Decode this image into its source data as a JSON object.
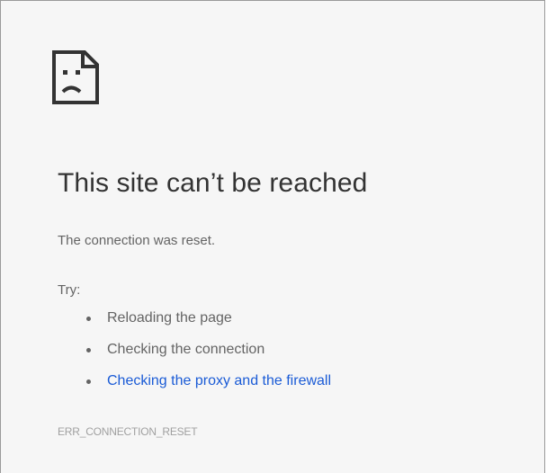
{
  "icon": {
    "name": "sad-page-icon"
  },
  "error": {
    "heading": "This site can’t be reached",
    "message": "The connection was reset.",
    "try_label": "Try:",
    "suggestions": [
      {
        "label": "Reloading the page"
      },
      {
        "label": "Checking the connection"
      },
      {
        "label": "Checking the proxy and the firewall"
      }
    ],
    "code": "ERR_CONNECTION_RESET"
  },
  "colors": {
    "background": "#f6f6f6",
    "heading_text": "#333333",
    "body_text": "#646464",
    "link": "#1a5bd6",
    "error_code": "#a0a0a0"
  }
}
